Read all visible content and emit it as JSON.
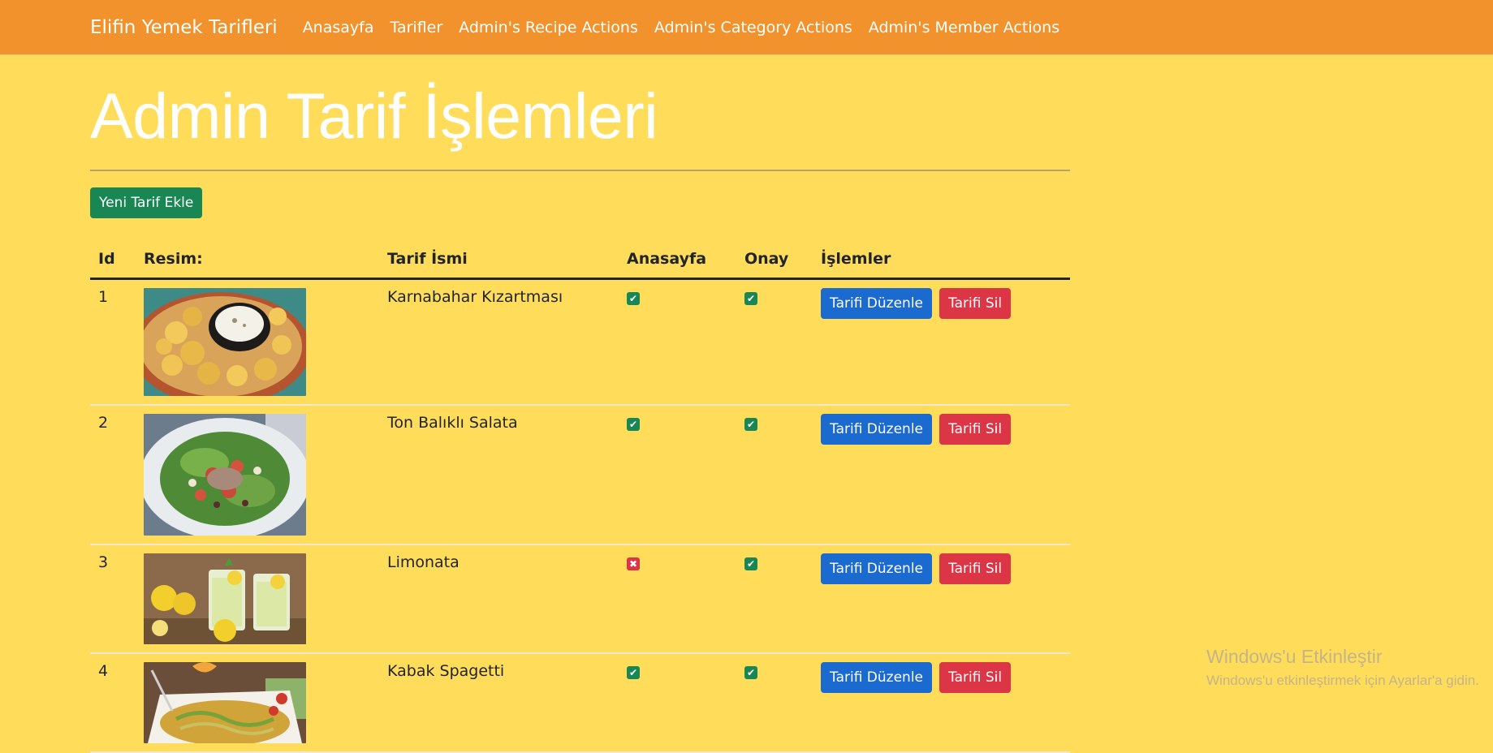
{
  "navbar": {
    "brand": "Elifin Yemek Tarifleri",
    "links": [
      "Anasayfa",
      "Tarifler",
      "Admin's Recipe Actions",
      "Admin's Category Actions",
      "Admin's Member Actions"
    ]
  },
  "page": {
    "title": "Admin Tarif İşlemleri",
    "add_button": "Yeni Tarif Ekle"
  },
  "table": {
    "headers": [
      "Id",
      "Resim:",
      "Tarif İsmi",
      "Anasayfa",
      "Onay",
      "İşlemler"
    ],
    "rows": [
      {
        "id": "1",
        "image": "fried-cauliflower-photo",
        "name": "Karnabahar Kızartması",
        "homepage": true,
        "approved": true,
        "edit": "Tarifi Düzenle",
        "delete": "Tarifi Sil"
      },
      {
        "id": "2",
        "image": "tuna-salad-photo",
        "name": "Ton Balıklı Salata",
        "homepage": true,
        "approved": true,
        "edit": "Tarifi Düzenle",
        "delete": "Tarifi Sil"
      },
      {
        "id": "3",
        "image": "lemonade-photo",
        "name": "Limonata",
        "homepage": false,
        "approved": true,
        "edit": "Tarifi Düzenle",
        "delete": "Tarifi Sil"
      },
      {
        "id": "4",
        "image": "zucchini-spaghetti-photo",
        "name": "Kabak Spagetti",
        "homepage": true,
        "approved": true,
        "edit": "Tarifi Düzenle",
        "delete": "Tarifi Sil"
      }
    ]
  },
  "watermark": {
    "title": "Windows'u Etkinleştir",
    "subtitle": "Windows'u etkinleştirmek için Ayarlar'a gidin."
  },
  "colors": {
    "navbar": "#f1922c",
    "background": "#ffdd5a",
    "success": "#198754",
    "primary": "#1b6ad0",
    "danger": "#dc3545"
  }
}
